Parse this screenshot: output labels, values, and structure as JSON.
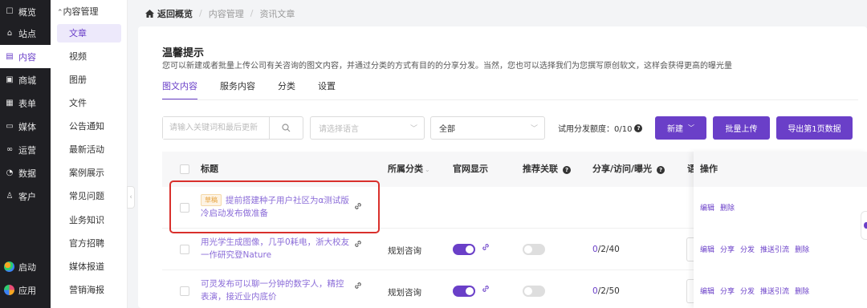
{
  "nav": {
    "items": [
      {
        "label": "概览",
        "icon": "dashboard-icon",
        "glyph": "☐"
      },
      {
        "label": "站点",
        "icon": "home-icon",
        "glyph": "⌂"
      },
      {
        "label": "内容",
        "icon": "document-icon",
        "glyph": "▤"
      },
      {
        "label": "商城",
        "icon": "shop-icon",
        "glyph": "▣"
      },
      {
        "label": "表单",
        "icon": "form-icon",
        "glyph": "▦"
      },
      {
        "label": "媒体",
        "icon": "video-icon",
        "glyph": "▭"
      },
      {
        "label": "运营",
        "icon": "link-icon",
        "glyph": "∞"
      },
      {
        "label": "数据",
        "icon": "chart-icon",
        "glyph": "◔"
      },
      {
        "label": "客户",
        "icon": "user-icon",
        "glyph": "♙"
      }
    ],
    "bottom": [
      {
        "label": "启动",
        "icon": "launch-icon",
        "color": "#f5a623"
      },
      {
        "label": "应用",
        "icon": "apps-icon",
        "color": "#e94e77"
      }
    ],
    "active_index": 2
  },
  "submenu": {
    "header": "内容管理",
    "items": [
      "文章",
      "视频",
      "图册",
      "文件",
      "公告通知",
      "最新活动",
      "案例展示",
      "常见问题",
      "业务知识",
      "官方招聘",
      "媒体报道",
      "营销海报"
    ],
    "active_index": 0
  },
  "breadcrumb": {
    "home": "返回概览",
    "items": [
      "内容管理",
      "资讯文章"
    ]
  },
  "tip": {
    "title": "温馨提示",
    "desc": "您可以新建或者批量上传公司有关咨询的图文内容，并通过分类的方式有目的的分享分发。当然，您也可以选择我们为您撰写原创软文，这样会获得更高的曝光量"
  },
  "tabs": [
    "图文内容",
    "服务内容",
    "分类",
    "设置"
  ],
  "filters": {
    "search_placeholder": "请输入关键词和最后更新",
    "language_placeholder": "请选择语言",
    "status_value": "全部",
    "quota_label": "试用分发额度：0/10"
  },
  "buttons": {
    "create": "新建",
    "bulk_upload": "批量上传",
    "export": "导出第1页数据"
  },
  "table": {
    "headers": {
      "title": "标题",
      "category": "所属分类",
      "site_display": "官网显示",
      "recommend": "推荐关联",
      "stats": "分享/访问/曝光",
      "lang": "语",
      "ops": "操作"
    },
    "rows": [
      {
        "draft": "草稿",
        "title_l1": "提前搭建种子用户社区为α测试版",
        "title_l2": "冷启动发布做准备",
        "category": "",
        "site_on": null,
        "recommend_on": null,
        "stats_first": "",
        "stats_rest": "",
        "ops": [
          "编辑",
          "删除"
        ]
      },
      {
        "draft": "",
        "title_l1": "用光学生成图像，几乎0耗电，浙大校友",
        "title_l2": "一作研究登Nature",
        "category": "规划咨询",
        "site_on": true,
        "recommend_on": false,
        "stats_first": "0",
        "stats_rest": "/2/40",
        "ops": [
          "编辑",
          "分享",
          "分发",
          "推送引流",
          "删除"
        ]
      },
      {
        "draft": "",
        "title_l1": "可灵发布可以聊一分钟的数字人，精控",
        "title_l2": "表演，接近业内底价",
        "category": "规划咨询",
        "site_on": true,
        "recommend_on": false,
        "stats_first": "0",
        "stats_rest": "/2/50",
        "ops": [
          "编辑",
          "分享",
          "分发",
          "推送引流",
          "删除"
        ]
      }
    ]
  },
  "colors": {
    "accent": "#6a3fc8",
    "highlight_border": "#d9302c"
  }
}
